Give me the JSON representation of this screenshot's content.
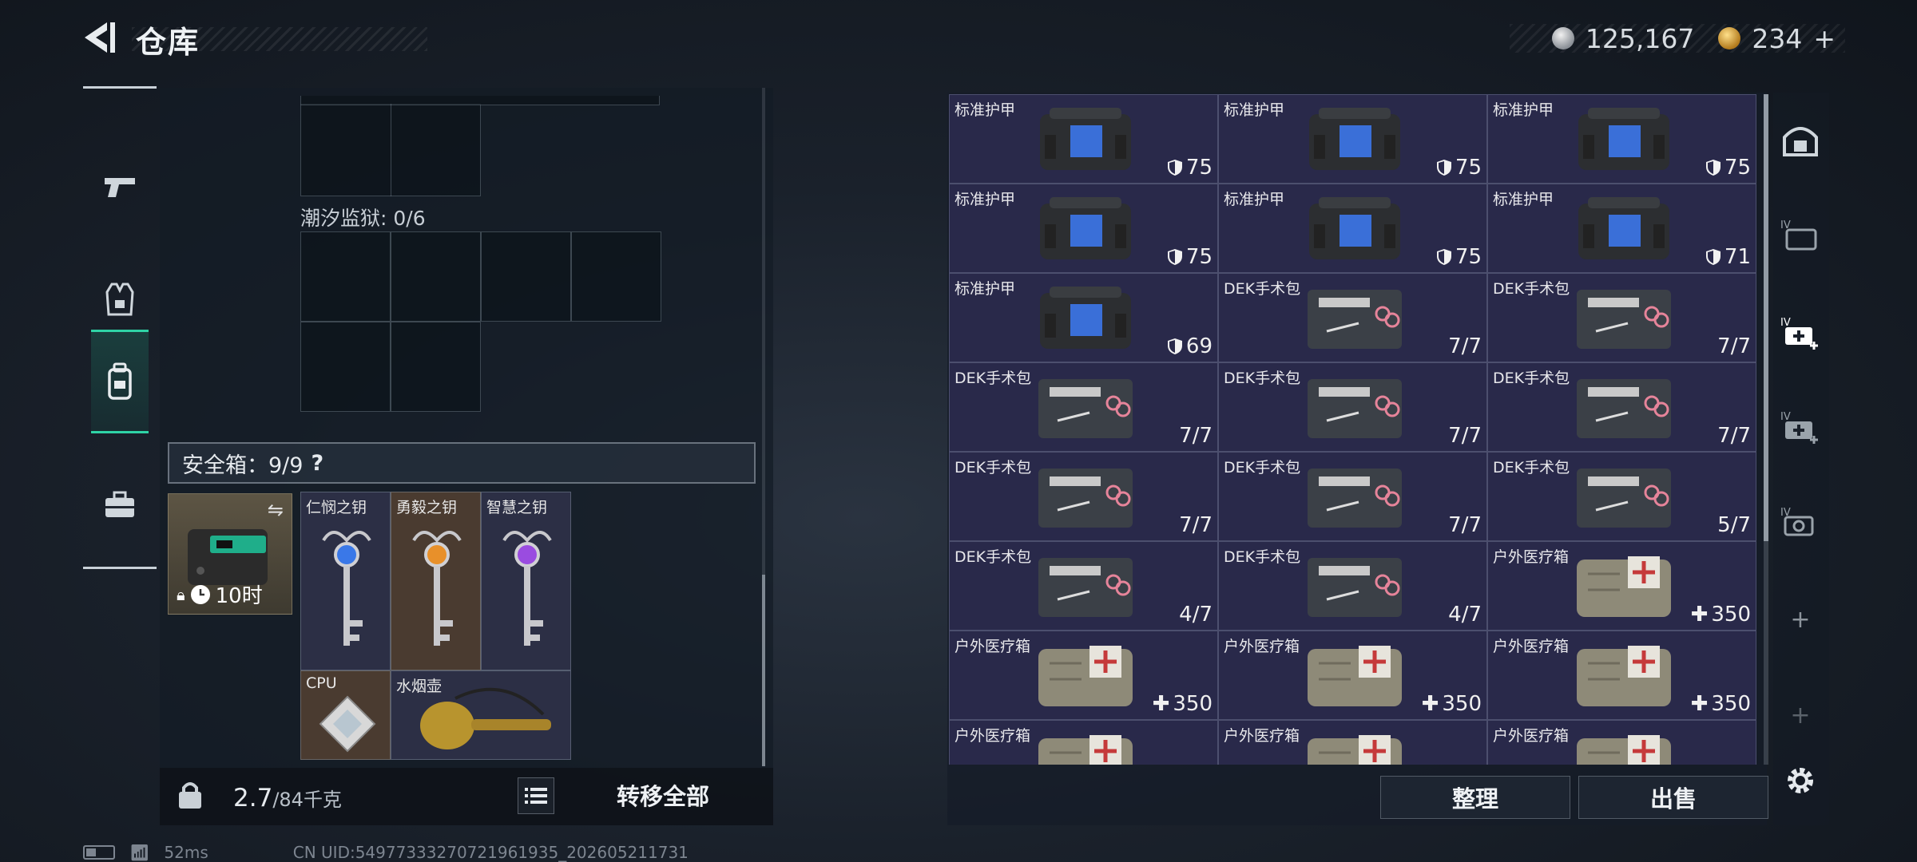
{
  "header": {
    "title": "仓库"
  },
  "currency": {
    "silver": "125,167",
    "gold": "234",
    "gold_add": "+"
  },
  "safe_box": {
    "label": "安全箱：9/9",
    "help": "?",
    "timer": "10时",
    "grid_label": "潮汐监狱: 0/6"
  },
  "safe_items": [
    {
      "name": "仁悯之钥"
    },
    {
      "name": "勇毅之钥"
    },
    {
      "name": "智慧之钥"
    },
    {
      "name": "CPU"
    },
    {
      "name": "水烟壶"
    }
  ],
  "bottom": {
    "weight_current": "2.7",
    "weight_max": "/84千克",
    "transfer_all": "转移全部"
  },
  "inventory": [
    {
      "name": "标准护甲",
      "value": "75",
      "kind": "armor"
    },
    {
      "name": "标准护甲",
      "value": "75",
      "kind": "armor"
    },
    {
      "name": "标准护甲",
      "value": "75",
      "kind": "armor"
    },
    {
      "name": "标准护甲",
      "value": "75",
      "kind": "armor"
    },
    {
      "name": "标准护甲",
      "value": "75",
      "kind": "armor"
    },
    {
      "name": "标准护甲",
      "value": "71",
      "kind": "armor"
    },
    {
      "name": "标准护甲",
      "value": "69",
      "kind": "armor"
    },
    {
      "name": "DEK手术包",
      "value": "7/7",
      "kind": "surgery"
    },
    {
      "name": "DEK手术包",
      "value": "7/7",
      "kind": "surgery"
    },
    {
      "name": "DEK手术包",
      "value": "7/7",
      "kind": "surgery"
    },
    {
      "name": "DEK手术包",
      "value": "7/7",
      "kind": "surgery"
    },
    {
      "name": "DEK手术包",
      "value": "7/7",
      "kind": "surgery"
    },
    {
      "name": "DEK手术包",
      "value": "7/7",
      "kind": "surgery"
    },
    {
      "name": "DEK手术包",
      "value": "7/7",
      "kind": "surgery"
    },
    {
      "name": "DEK手术包",
      "value": "5/7",
      "kind": "surgery"
    },
    {
      "name": "DEK手术包",
      "value": "4/7",
      "kind": "surgery"
    },
    {
      "name": "DEK手术包",
      "value": "4/7",
      "kind": "surgery"
    },
    {
      "name": "户外医疗箱",
      "value": "350",
      "kind": "medkit"
    },
    {
      "name": "户外医疗箱",
      "value": "350",
      "kind": "medkit"
    },
    {
      "name": "户外医疗箱",
      "value": "350",
      "kind": "medkit"
    },
    {
      "name": "户外医疗箱",
      "value": "350",
      "kind": "medkit"
    },
    {
      "name": "户外医疗箱",
      "value": "",
      "kind": "medkit"
    },
    {
      "name": "户外医疗箱",
      "value": "",
      "kind": "medkit"
    },
    {
      "name": "户外医疗箱",
      "value": "",
      "kind": "medkit"
    }
  ],
  "actions": {
    "sort": "整理",
    "sell": "出售"
  },
  "status_bar": {
    "ping": "52ms",
    "uid": "CN UID:549773332707219619​35_202605211731"
  },
  "colors": {
    "accent": "#2fd3a6",
    "cell_bg": "#29294a"
  }
}
